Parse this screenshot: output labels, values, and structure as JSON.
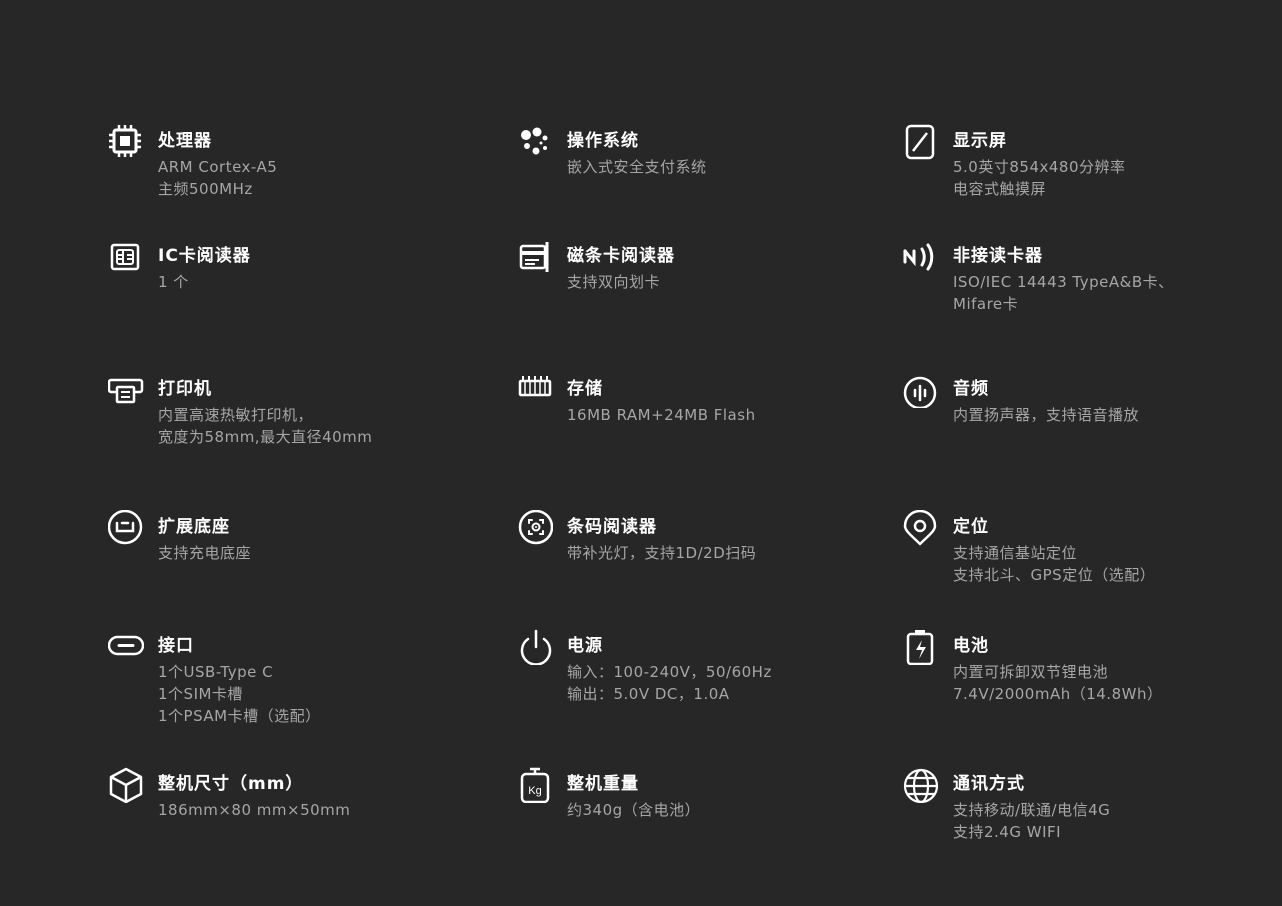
{
  "colors": {
    "background": "#272727",
    "title": "#ffffff",
    "text": "#a6a6a6",
    "icon": "#ffffff"
  },
  "specs": [
    {
      "icon": "cpu-icon",
      "title": "处理器",
      "lines": [
        "ARM Cortex-A5",
        "主频500MHz"
      ]
    },
    {
      "icon": "os-dots-icon",
      "title": "操作系统",
      "lines": [
        "嵌入式安全支付系统"
      ]
    },
    {
      "icon": "display-icon",
      "title": "显示屏",
      "lines": [
        "5.0英寸854x480分辨率",
        "电容式触摸屏"
      ]
    },
    {
      "icon": "ic-chip-card-icon",
      "title": "IC卡阅读器",
      "lines": [
        "1 个"
      ]
    },
    {
      "icon": "magstripe-card-icon",
      "title": "磁条卡阅读器",
      "lines": [
        "支持双向划卡"
      ]
    },
    {
      "icon": "nfc-icon",
      "title": "非接读卡器",
      "lines": [
        "ISO/IEC 14443 TypeA&B卡、",
        "Mifare卡"
      ]
    },
    {
      "icon": "printer-icon",
      "title": "打印机",
      "lines": [
        "内置高速热敏打印机，",
        "宽度为58mm,最大直径40mm"
      ]
    },
    {
      "icon": "memory-icon",
      "title": "存储",
      "lines": [
        "16MB RAM+24MB Flash"
      ]
    },
    {
      "icon": "audio-icon",
      "title": "音频",
      "lines": [
        "内置扬声器，支持语音播放"
      ]
    },
    {
      "icon": "dock-icon",
      "title": "扩展底座",
      "lines": [
        "支持充电底座"
      ]
    },
    {
      "icon": "barcode-scanner-icon",
      "title": "条码阅读器",
      "lines": [
        "带补光灯，支持1D/2D扫码"
      ]
    },
    {
      "icon": "location-pin-icon",
      "title": "定位",
      "lines": [
        "支持通信基站定位",
        "支持北斗、GPS定位（选配）"
      ]
    },
    {
      "icon": "usb-c-port-icon",
      "title": "接口",
      "lines": [
        "1个USB-Type C",
        "1个SIM卡槽",
        "1个PSAM卡槽（选配）"
      ]
    },
    {
      "icon": "power-icon",
      "title": "电源",
      "lines": [
        "输入：100-240V，50/60Hz",
        "输出：5.0V DC，1.0A"
      ]
    },
    {
      "icon": "battery-icon",
      "title": "电池",
      "lines": [
        "内置可拆卸双节锂电池",
        "7.4V/2000mAh（14.8Wh）"
      ]
    },
    {
      "icon": "cube-icon",
      "title": "整机尺寸（mm）",
      "lines": [
        "186mm×80 mm×50mm"
      ]
    },
    {
      "icon": "weight-icon",
      "title": "整机重量",
      "weight_label": "Kg",
      "lines": [
        "约340g（含电池）"
      ]
    },
    {
      "icon": "globe-icon",
      "title": "通讯方式",
      "lines": [
        "支持移动/联通/电信4G",
        "支持2.4G WIFI"
      ]
    }
  ]
}
